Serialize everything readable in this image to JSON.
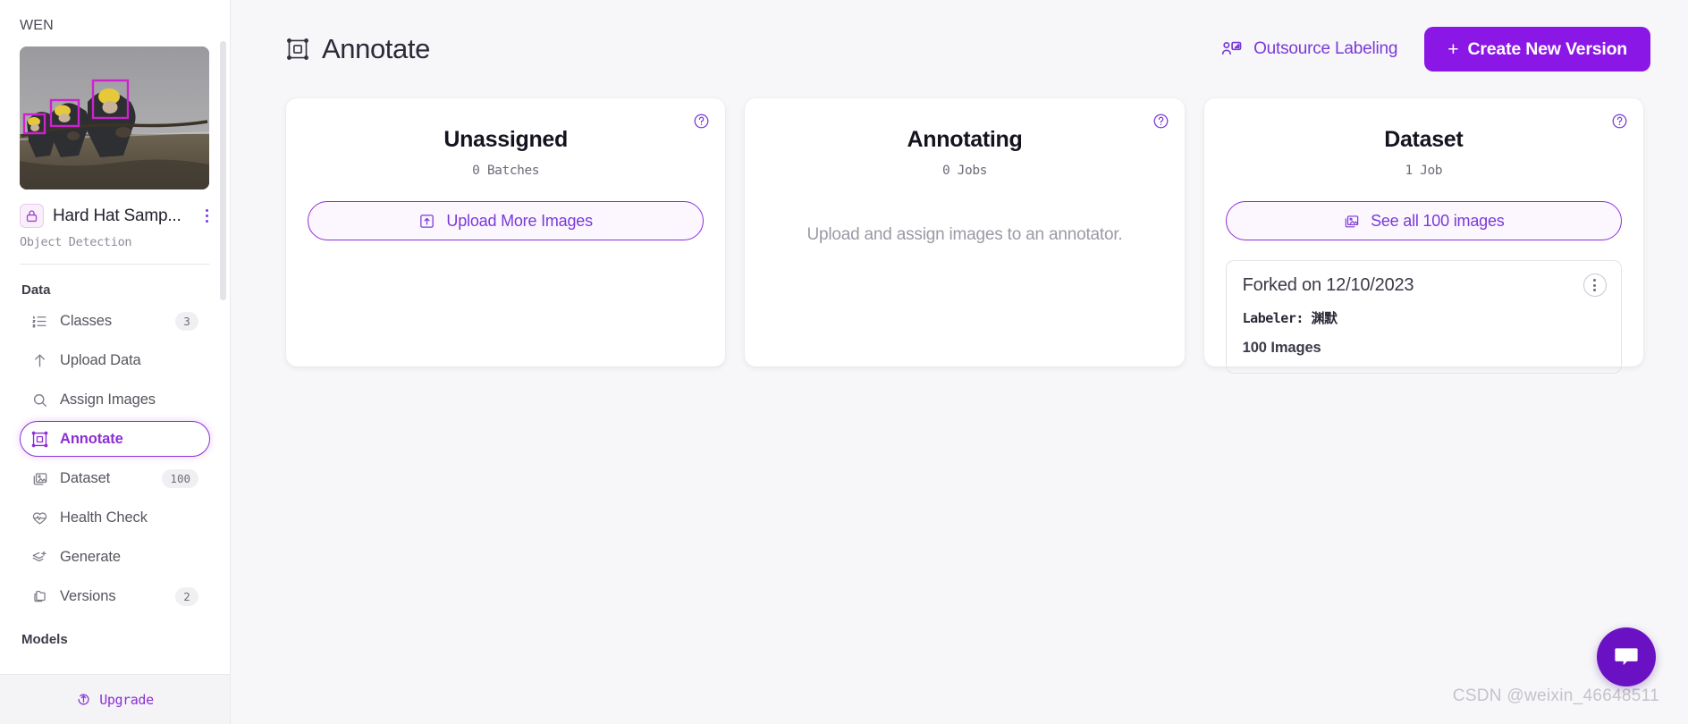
{
  "sidebar": {
    "workspace_name": "WEN",
    "thumbnail_alt": "hard-hat-workers-pulling-rope",
    "project": {
      "title": "Hard Hat Samp...",
      "type": "Object Detection",
      "lock_icon": "lock-icon",
      "menu_icon": "kebab-menu-icon"
    },
    "sections": [
      {
        "title": "Data",
        "items": [
          {
            "label": "Classes",
            "icon": "list-icon",
            "badge": "3",
            "active": false
          },
          {
            "label": "Upload Data",
            "icon": "upload-arrow-icon",
            "badge": "",
            "active": false
          },
          {
            "label": "Assign Images",
            "icon": "search-icon",
            "badge": "",
            "active": false
          },
          {
            "label": "Annotate",
            "icon": "annotate-icon",
            "badge": "",
            "active": true
          },
          {
            "label": "Dataset",
            "icon": "images-icon",
            "badge": "100",
            "active": false
          },
          {
            "label": "Health Check",
            "icon": "heart-pulse-icon",
            "badge": "",
            "active": false
          },
          {
            "label": "Generate",
            "icon": "layers-plus-icon",
            "badge": "",
            "active": false
          },
          {
            "label": "Versions",
            "icon": "folder-icon",
            "badge": "2",
            "active": false
          }
        ]
      },
      {
        "title": "Models",
        "items": []
      }
    ],
    "upgrade": {
      "label": "Upgrade",
      "icon": "upgrade-arrow-icon"
    }
  },
  "header": {
    "title": "Annotate",
    "title_icon": "annotate-icon",
    "outsource": {
      "label": "Outsource Labeling",
      "icon": "outsource-labeling-icon"
    },
    "create_version": {
      "label": "Create New Version",
      "plus": "+"
    }
  },
  "cards": [
    {
      "title": "Unassigned",
      "subtitle": "0 Batches",
      "help_icon": "help-circle-icon",
      "action": {
        "label": "Upload More Images",
        "icon": "upload-box-icon"
      },
      "empty_message": "",
      "job": null
    },
    {
      "title": "Annotating",
      "subtitle": "0 Jobs",
      "help_icon": "help-circle-icon",
      "action": null,
      "empty_message": "Upload and assign images to an annotator.",
      "job": null
    },
    {
      "title": "Dataset",
      "subtitle": "1 Job",
      "help_icon": "help-circle-icon",
      "action": {
        "label": "See all 100 images",
        "icon": "images-icon"
      },
      "empty_message": "",
      "job": {
        "title": "Forked on 12/10/2023",
        "labeler_label": "Labeler:",
        "labeler_name": "渊默",
        "images": "100 Images",
        "menu_icon": "kebab-menu-icon"
      }
    }
  ],
  "watermark": "CSDN @weixin_46648511",
  "chat": {
    "icon": "chat-bubble-icon"
  },
  "colors": {
    "accent": "#8b17e6",
    "accent_text": "#7a39d9",
    "active_border": "#8b2fd6",
    "page_bg": "#f7f7f9",
    "card_bg": "#ffffff"
  }
}
